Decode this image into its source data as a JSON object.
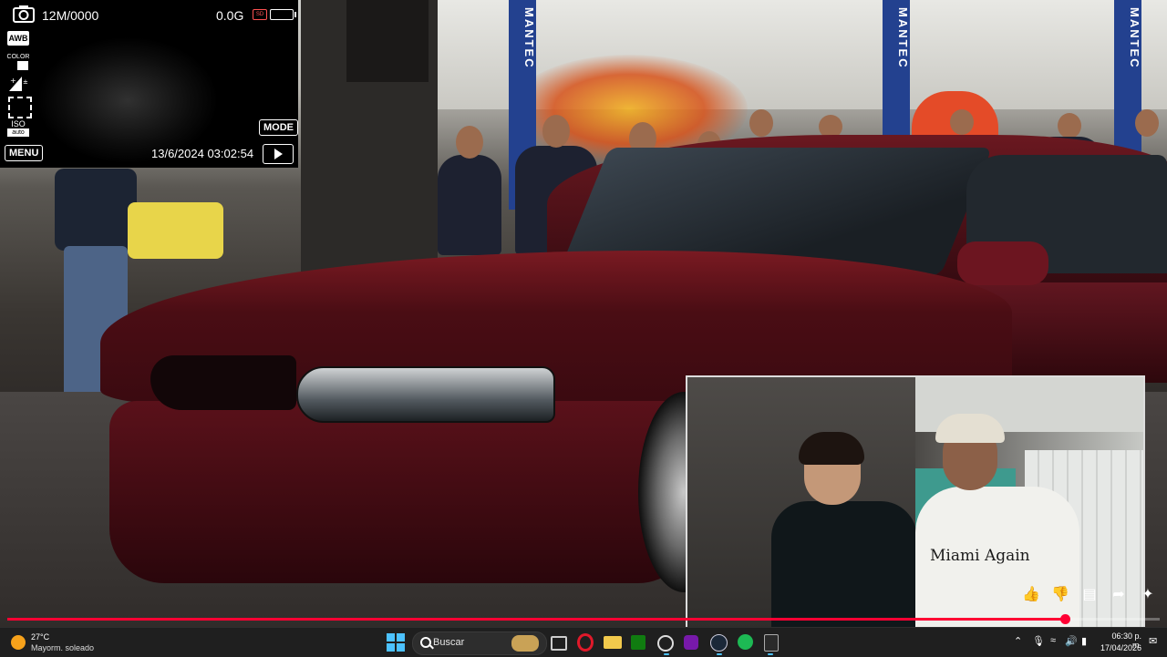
{
  "camera": {
    "resolution": "12M/0000",
    "gforce": "0.0G",
    "sd_label": "SD",
    "awb": "AWB",
    "color_label": "COLOR",
    "iso_label": "ISO",
    "iso_value": "auto",
    "mode_label": "MODE",
    "menu_label": "MENU",
    "datetime": "13/6/2024 03:02:54"
  },
  "video": {
    "signs": [
      "MANTEC",
      "MANTEC",
      "MANTEC"
    ],
    "pip_shirt_text": "Miami Again",
    "progress_fraction": 0.918,
    "accent": "#ff0033"
  },
  "pip_actions": [
    "thumbs-up-icon",
    "thumbs-down-icon",
    "comment-icon",
    "share-icon",
    "sparkle-icon"
  ],
  "taskbar": {
    "weather_temp": "27°C",
    "weather_desc": "Mayorm. soleado",
    "search_placeholder": "Buscar",
    "clock_time": "06:30 p. m.",
    "clock_date": "17/04/2026",
    "apps": [
      "task-view-icon",
      "opera-icon",
      "file-explorer-icon",
      "xbox-icon",
      "chrome-icon",
      "onenote-icon",
      "steam-icon",
      "spotify-icon",
      "epic-games-icon"
    ]
  }
}
